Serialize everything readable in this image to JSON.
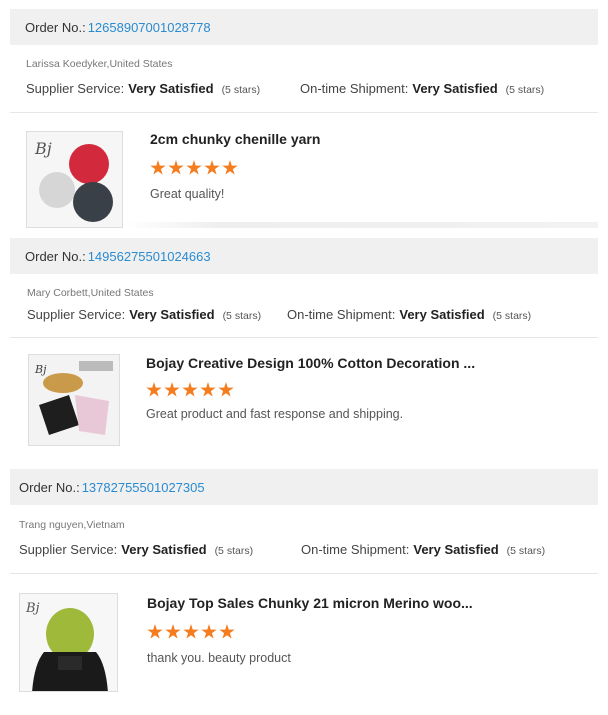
{
  "order_prefix": "Order No.:",
  "reviews": [
    {
      "order_no": "12658907001028778",
      "buyer": "Larissa Koedyker,United States",
      "supplier_label": "Supplier Service:",
      "supplier_value": "Very Satisfied",
      "supplier_stars": "(5 stars)",
      "shipment_label": "On-time Shipment:",
      "shipment_value": "Very Satisfied",
      "shipment_stars": "(5 stars)",
      "product_title": "2cm chunky chenille yarn",
      "rating": 5,
      "comment": "Great quality!"
    },
    {
      "order_no": "14956275501024663",
      "buyer": "Mary Corbett,United States",
      "supplier_label": "Supplier Service:",
      "supplier_value": "Very Satisfied",
      "supplier_stars": "(5 stars)",
      "shipment_label": "On-time Shipment:",
      "shipment_value": "Very Satisfied",
      "shipment_stars": "(5 stars)",
      "product_title": "Bojay Creative Design 100% Cotton Decoration ...",
      "rating": 5,
      "comment": "Great product and fast response and shipping."
    },
    {
      "order_no": "13782755501027305",
      "buyer": "Trang nguyen,Vietnam",
      "supplier_label": "Supplier Service:",
      "supplier_value": "Very Satisfied",
      "supplier_stars": "(5 stars)",
      "shipment_label": "On-time Shipment:",
      "shipment_value": "Very Satisfied",
      "shipment_stars": "(5 stars)",
      "product_title": "Bojay Top Sales Chunky 21 micron Merino woo...",
      "rating": 5,
      "comment": "thank you. beauty product"
    }
  ],
  "colors": {
    "order_number": "#2a8bd0",
    "star": "#f57c1f",
    "bar_bg": "#f0f0f0"
  }
}
